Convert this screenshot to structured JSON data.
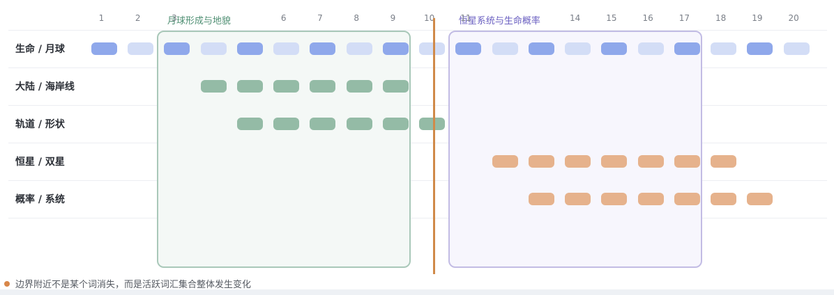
{
  "columns": [
    "1",
    "2",
    "3",
    "4",
    "5",
    "6",
    "7",
    "8",
    "9",
    "10",
    "11",
    "12",
    "13",
    "14",
    "15",
    "16",
    "17",
    "18",
    "19",
    "20"
  ],
  "rows": [
    "生命 / 月球",
    "大陆 / 海岸线",
    "轨道 / 形状",
    "恒星 / 双星",
    "概率 / 系统"
  ],
  "regions": [
    {
      "title": "月球形成与地貌",
      "from_col": 3,
      "to_col": 9,
      "border": "#a9c8b9",
      "fill": "#f4f8f6",
      "text_color": "#4f8f73"
    },
    {
      "title": "恒星系统与生命概率",
      "from_col": 11,
      "to_col": 17,
      "border": "#c2bce4",
      "fill": "#f7f6fd",
      "text_color": "#6a5fc1"
    }
  ],
  "boundary_after_col": 10,
  "boundary_color": "#d08a4a",
  "colors": {
    "blue_strong": "#8fa8eb",
    "blue_light": "#d3ddf6",
    "green": "#94bba6",
    "orange": "#e6b28c"
  },
  "cells": [
    {
      "row": 0,
      "cols": [
        1,
        3,
        5,
        7,
        9,
        11,
        13,
        15,
        17,
        19
      ],
      "color": "blue_strong"
    },
    {
      "row": 0,
      "cols": [
        2,
        4,
        6,
        8,
        10,
        12,
        14,
        16,
        18,
        20
      ],
      "color": "blue_light"
    },
    {
      "row": 1,
      "cols": [
        4,
        5,
        6,
        7,
        8,
        9
      ],
      "color": "green"
    },
    {
      "row": 2,
      "cols": [
        5,
        6,
        7,
        8,
        9,
        10
      ],
      "color": "green"
    },
    {
      "row": 3,
      "cols": [
        12,
        13,
        14,
        15,
        16,
        17,
        18
      ],
      "color": "orange"
    },
    {
      "row": 4,
      "cols": [
        13,
        14,
        15,
        16,
        17,
        18,
        19
      ],
      "color": "orange"
    }
  ],
  "footnote": "边界附近不是某个词消失，而是活跃词汇集合整体发生变化"
}
